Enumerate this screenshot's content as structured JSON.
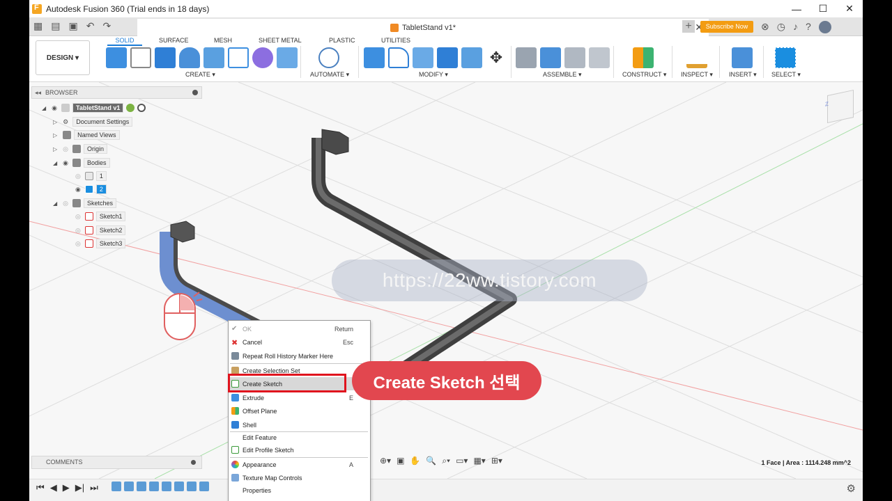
{
  "title": "Autodesk Fusion 360 (Trial ends in 18 days)",
  "window_controls": [
    "—",
    "☐",
    "✕"
  ],
  "doc_tab": {
    "name": "TabletStand v1*"
  },
  "subscribe": "Subscribe Now",
  "design_btn": "DESIGN ▾",
  "tabs": [
    "SOLID",
    "SURFACE",
    "MESH",
    "SHEET METAL",
    "PLASTIC",
    "UTILITIES"
  ],
  "groups": [
    "CREATE ▾",
    "AUTOMATE ▾",
    "MODIFY ▾",
    "ASSEMBLE ▾",
    "CONSTRUCT ▾",
    "INSPECT ▾",
    "INSERT ▾",
    "SELECT ▾"
  ],
  "browser": {
    "header": "BROWSER",
    "items": [
      {
        "label": "TabletStand v1"
      },
      {
        "label": "Document Settings"
      },
      {
        "label": "Named Views"
      },
      {
        "label": "Origin"
      },
      {
        "label": "Bodies"
      },
      {
        "label": "1"
      },
      {
        "label": "2"
      },
      {
        "label": "Sketches"
      },
      {
        "label": "Sketch1"
      },
      {
        "label": "Sketch2"
      },
      {
        "label": "Sketch3"
      }
    ]
  },
  "comments": "COMMENTS",
  "status": "1 Face | Area : 1114.248 mm^2",
  "context_menu": [
    {
      "label": "OK",
      "shortcut": "Return"
    },
    {
      "label": "Cancel",
      "shortcut": "Esc"
    },
    {
      "label": "Repeat Roll History Marker Here",
      "shortcut": ""
    },
    {
      "label": "Create Selection Set",
      "shortcut": ""
    },
    {
      "label": "Create Sketch",
      "shortcut": ""
    },
    {
      "label": "Extrude",
      "shortcut": "E"
    },
    {
      "label": "Offset Plane",
      "shortcut": ""
    },
    {
      "label": "Shell",
      "shortcut": ""
    },
    {
      "label": "Edit Feature",
      "shortcut": ""
    },
    {
      "label": "Edit Profile Sketch",
      "shortcut": ""
    },
    {
      "label": "Appearance",
      "shortcut": "A"
    },
    {
      "label": "Texture Map Controls",
      "shortcut": ""
    },
    {
      "label": "Properties",
      "shortcut": ""
    }
  ],
  "callout": "Create Sketch 선택",
  "watermark": "https://22ww.tistory.com",
  "colors": {
    "accent": "#1a7bd6",
    "highlight_red": "#e0141e",
    "callout_bg": "#e2474f",
    "subscribe": "#f39c12"
  }
}
